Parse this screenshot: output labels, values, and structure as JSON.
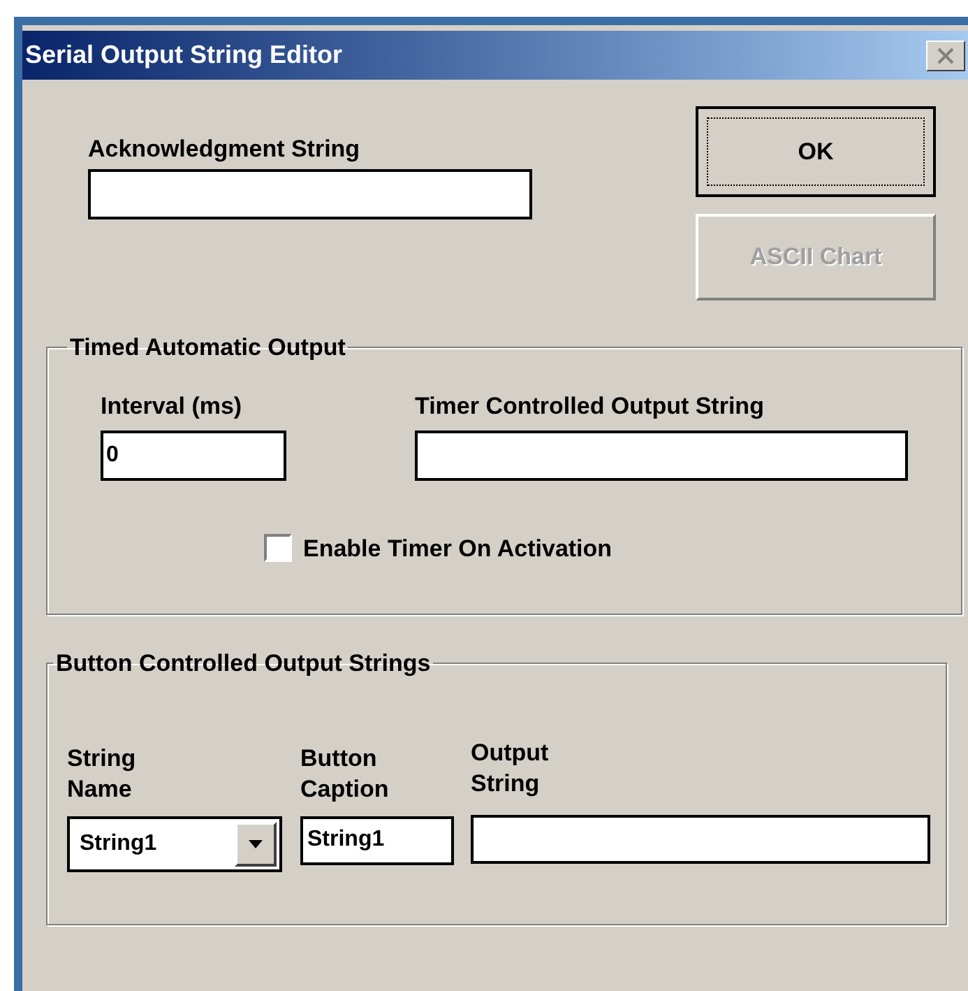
{
  "window": {
    "title": "Serial Output String Editor"
  },
  "acknowledgment": {
    "label": "Acknowledgment String"
  },
  "buttons": [
    {
      "label": "OK",
      "default": true,
      "disabled": false
    },
    {
      "label": "ASCII Chart",
      "default": false,
      "disabled": true
    }
  ],
  "timed_output": {
    "title": "Timed Automatic Output",
    "interval": {
      "label": "Interval (ms)",
      "value": "0"
    },
    "timer_string": {
      "label": "Timer Controlled Output String"
    },
    "enable_timer": {
      "label": "Enable Timer On Activation",
      "checked": false
    }
  },
  "button_strings": {
    "title": "Button Controlled Output Strings",
    "string_name": {
      "label": "String Name",
      "value": "String1"
    },
    "caption": {
      "label": "Button Caption",
      "value": "String1"
    },
    "output": {
      "label": "Output String"
    }
  }
}
